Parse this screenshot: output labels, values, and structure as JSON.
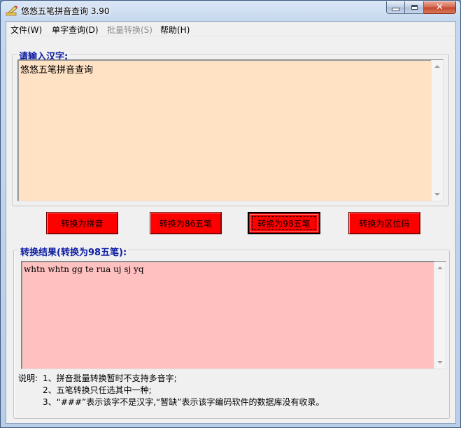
{
  "window": {
    "title": "悠悠五笔拼音查询 3.90",
    "controls": {
      "minimize": "–",
      "maximize": "□",
      "close": "✕"
    }
  },
  "menu": [
    {
      "label": "文件(W)",
      "enabled": true
    },
    {
      "label": "单字查询(D)",
      "enabled": true
    },
    {
      "label": "批量转换(S)",
      "enabled": false
    },
    {
      "label": "帮助(H)",
      "enabled": true
    }
  ],
  "input_group": {
    "legend": "请输入汉字:",
    "value": "悠悠五笔拼音查询",
    "background": "#ffe1c4"
  },
  "buttons": [
    {
      "label": "转换为拼音",
      "active": false
    },
    {
      "label": "转换为86五笔",
      "active": false
    },
    {
      "label": "转换为98五笔",
      "active": true
    },
    {
      "label": "转换为区位码",
      "active": false
    }
  ],
  "result_group": {
    "legend": "转换结果(转换为98五笔):",
    "value": "whtn whtn gg te rua uj sj yq",
    "background": "#ffc0c0"
  },
  "notes": {
    "prefix": "说明:",
    "lines": [
      "1、拼音批量转换暂时不支持多音字;",
      "2、五笔转换只任选其中一种;",
      "3、“###”表示该字不是汉字,“暂缺”表示该字编码软件的数据库没有收录。"
    ]
  },
  "colors": {
    "button_red": "#ff0000",
    "legend_blue": "#0a1aa0"
  }
}
